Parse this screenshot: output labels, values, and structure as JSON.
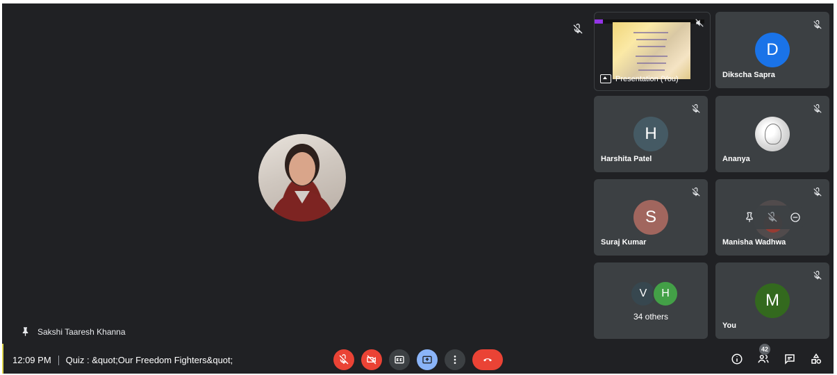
{
  "main": {
    "speaker_name": "Sakshi Taaresh Khanna",
    "icons": {
      "pin": "pin-icon",
      "mic_off": "mic-off-icon"
    }
  },
  "tiles": {
    "presentation": {
      "label": "Presentation (You)",
      "icon": "present-to-all-icon"
    },
    "dikscha": {
      "name": "Dikscha Sapra",
      "initial": "D",
      "color": "#1a73e8"
    },
    "harshita": {
      "name": "Harshita Patel",
      "initial": "H",
      "color": "#455a64"
    },
    "ananya": {
      "name": "Ananya"
    },
    "suraj": {
      "name": "Suraj Kumar",
      "initial": "S",
      "color": "#a1665e"
    },
    "manisha": {
      "name": "Manisha Wadhwa",
      "hover_controls": [
        "pin-icon",
        "mic-off-icon",
        "remove-icon"
      ]
    },
    "others": {
      "label": "34 others",
      "avatars": [
        {
          "initial": "V",
          "color": "#37474f"
        },
        {
          "initial": "H",
          "color": "#43a047"
        }
      ]
    },
    "you": {
      "name": "You",
      "initial": "M",
      "color": "#33691e"
    }
  },
  "bottom_bar": {
    "time": "12:09 PM",
    "meeting_title": "Quiz : &quot;Our Freedom Fighters&quot;",
    "participant_count": "42",
    "controls": [
      "mic-off-icon",
      "camera-off-icon",
      "captions-icon",
      "present-icon",
      "more-options-icon",
      "end-call-icon"
    ],
    "right_icons": [
      "info-icon",
      "people-icon",
      "chat-icon",
      "activities-icon"
    ]
  }
}
